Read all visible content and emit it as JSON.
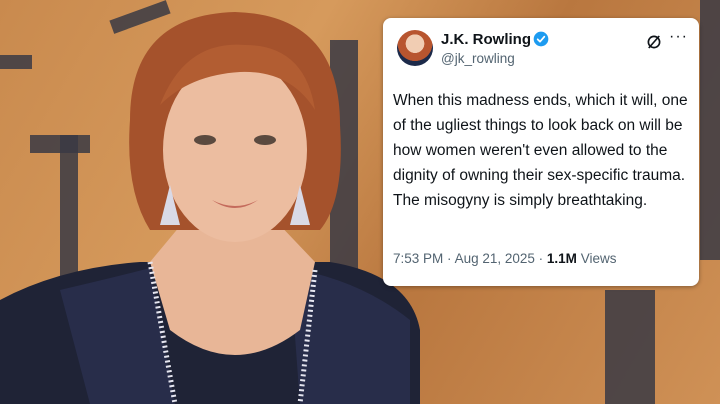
{
  "photo": {
    "description_icon": "person-photo"
  },
  "tweet": {
    "display_name": "J.K. Rowling",
    "handle": "@jk_rowling",
    "verified_icon": "verified-badge-icon",
    "grok_icon": "grok-icon",
    "more_label": "···",
    "text": "When this madness ends, which it will, one of the ugliest things to look back on will be how women weren't even allowed to the dignity of owning their sex-specific trauma. The misogyny is simply breathtaking.",
    "time": "7:53 PM",
    "date": "Aug 21, 2025",
    "views_count": "1.1M",
    "views_label": "Views"
  },
  "colors": {
    "verified": "#1d9bf0",
    "text": "#0f1419",
    "muted": "#536471"
  }
}
